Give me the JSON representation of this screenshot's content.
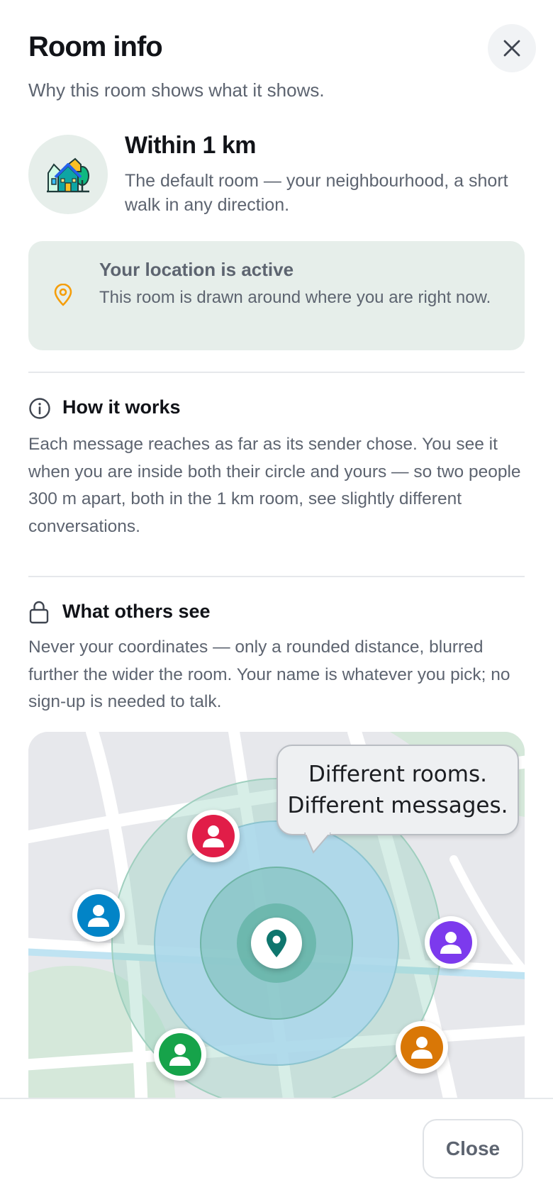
{
  "header": {
    "title": "Room info",
    "subtitle": "Why this room shows what it shows.",
    "close_icon": "close-icon"
  },
  "room": {
    "icon": "neighbourhood-houses-icon",
    "title": "Within 1 km",
    "description": "The default room — your neighbourhood, a short walk in any direction."
  },
  "location_card": {
    "icon": "location-pin-icon",
    "title": "Your location is active",
    "description": "This room is drawn around where you are right now."
  },
  "how_it_works": {
    "icon": "info-icon",
    "title": "How it works",
    "body": "Each message reaches as far as its sender chose. You see it when you are inside both their circle and yours — so two people 300 m apart, both in the 1 km room, see slightly different conversations."
  },
  "what_others_see": {
    "icon": "lock-icon",
    "title": "What others see",
    "body": "Never your coordinates — only a rounded distance, blurred further the wider the room. Your name is whatever you pick; no sign-up is needed to talk."
  },
  "illustration": {
    "bubble_line_1": "Different rooms.",
    "bubble_line_2": "Different messages.",
    "center_icon": "map-pin-icon",
    "avatars": [
      {
        "name": "avatar-red",
        "icon": "user-icon",
        "color": "#e11d48"
      },
      {
        "name": "avatar-blue",
        "icon": "user-icon",
        "color": "#0284c7"
      },
      {
        "name": "avatar-purple",
        "icon": "user-icon",
        "color": "#7c3aed"
      },
      {
        "name": "avatar-green",
        "icon": "user-icon",
        "color": "#16a34a"
      },
      {
        "name": "avatar-orange",
        "icon": "user-icon",
        "color": "#d97706"
      }
    ]
  },
  "footer": {
    "close_label": "Close"
  },
  "colors": {
    "accent_green": "#0f766e",
    "location_orange": "#f59e0b",
    "card_bg": "#e6eeea",
    "text_muted": "#5d6470"
  }
}
